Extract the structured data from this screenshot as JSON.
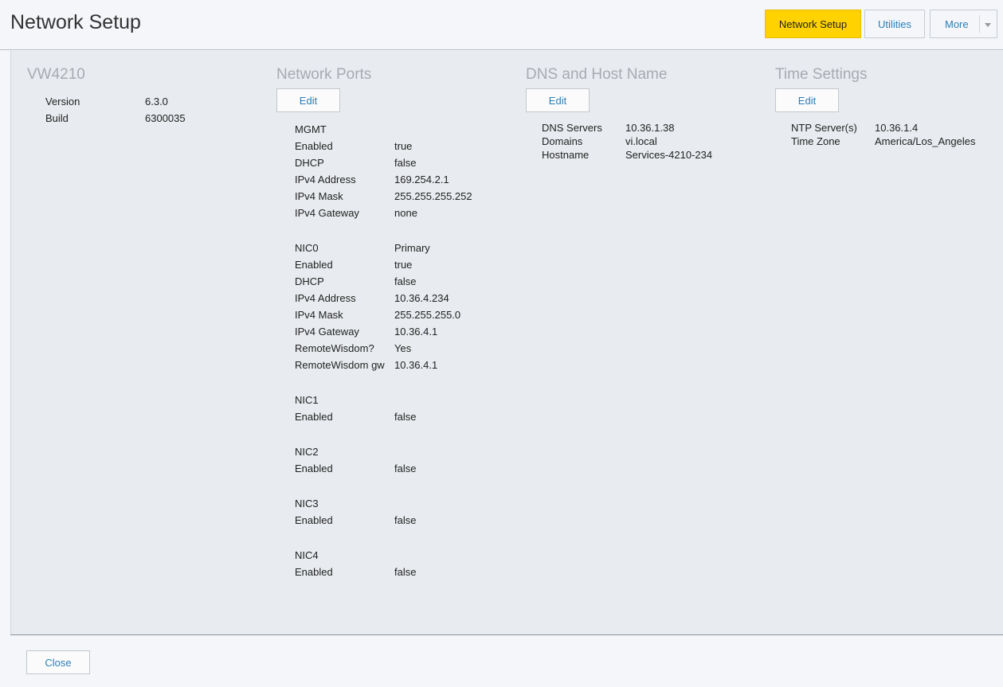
{
  "header": {
    "title": "Network Setup",
    "tabs": [
      {
        "label": "Network Setup",
        "active": true
      },
      {
        "label": "Utilities",
        "active": false
      },
      {
        "label": "More",
        "active": false
      }
    ]
  },
  "device": {
    "title": "VW4210",
    "rows": [
      {
        "label": "Version",
        "value": "6.3.0"
      },
      {
        "label": "Build",
        "value": "6300035"
      }
    ]
  },
  "network_ports": {
    "title": "Network Ports",
    "edit_label": "Edit",
    "groups": [
      {
        "rows": [
          {
            "label": "MGMT",
            "value": ""
          },
          {
            "label": "Enabled",
            "value": "true"
          },
          {
            "label": "DHCP",
            "value": "false"
          },
          {
            "label": "IPv4 Address",
            "value": "169.254.2.1"
          },
          {
            "label": "IPv4 Mask",
            "value": "255.255.255.252"
          },
          {
            "label": "IPv4 Gateway",
            "value": "none"
          }
        ]
      },
      {
        "rows": [
          {
            "label": "NIC0",
            "value": "Primary"
          },
          {
            "label": "Enabled",
            "value": "true"
          },
          {
            "label": "DHCP",
            "value": "false"
          },
          {
            "label": "IPv4 Address",
            "value": "10.36.4.234"
          },
          {
            "label": "IPv4 Mask",
            "value": "255.255.255.0"
          },
          {
            "label": "IPv4 Gateway",
            "value": "10.36.4.1"
          },
          {
            "label": "RemoteWisdom?",
            "value": "Yes"
          },
          {
            "label": "RemoteWisdom gw",
            "value": "10.36.4.1"
          }
        ]
      },
      {
        "rows": [
          {
            "label": "NIC1",
            "value": ""
          },
          {
            "label": "Enabled",
            "value": "false"
          }
        ]
      },
      {
        "rows": [
          {
            "label": "NIC2",
            "value": ""
          },
          {
            "label": "Enabled",
            "value": "false"
          }
        ]
      },
      {
        "rows": [
          {
            "label": "NIC3",
            "value": ""
          },
          {
            "label": "Enabled",
            "value": "false"
          }
        ]
      },
      {
        "rows": [
          {
            "label": "NIC4",
            "value": ""
          },
          {
            "label": "Enabled",
            "value": "false"
          }
        ]
      }
    ]
  },
  "dns": {
    "title": "DNS and Host Name",
    "edit_label": "Edit",
    "rows": [
      {
        "label": "DNS Servers",
        "value": "10.36.1.38"
      },
      {
        "label": "Domains",
        "value": "vi.local"
      },
      {
        "label": "Hostname",
        "value": "Services-4210-234"
      }
    ]
  },
  "time": {
    "title": "Time Settings",
    "edit_label": "Edit",
    "rows": [
      {
        "label": "NTP Server(s)",
        "value": "10.36.1.4"
      },
      {
        "label": "Time Zone",
        "value": "America/Los_Angeles"
      }
    ]
  },
  "footer": {
    "close_label": "Close"
  },
  "colors": {
    "accent": "#ffd200",
    "link": "#2a7fb8",
    "panel": "#e8ebef",
    "muted_title": "#a7abb1"
  }
}
